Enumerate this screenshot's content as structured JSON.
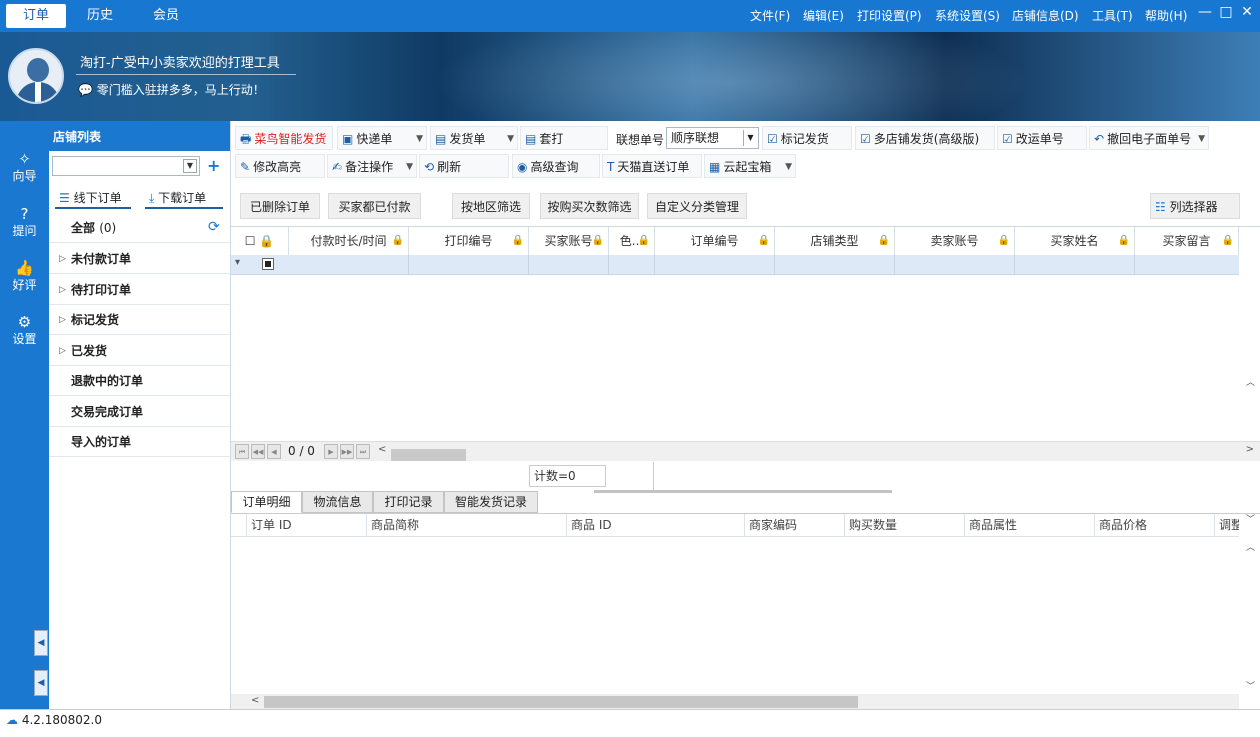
{
  "top_tabs": [
    "订单",
    "历史",
    "会员"
  ],
  "menu": [
    "文件(F)",
    "编辑(E)",
    "打印设置(P)",
    "系统设置(S)",
    "店铺信息(D)",
    "工具(T)",
    "帮助(H)"
  ],
  "window": {
    "minimize": "—",
    "maximize": "□",
    "close": "✕"
  },
  "banner": {
    "slogan1": "淘打-广受中小卖家欢迎的打理工具",
    "slogan2": "零门槛入驻拼多多，马上行动！"
  },
  "leftnav": [
    {
      "label": "向导",
      "icon": "wand-icon"
    },
    {
      "label": "提问",
      "icon": "question-icon"
    },
    {
      "label": "好评",
      "icon": "thumbs-up-icon"
    },
    {
      "label": "设置",
      "icon": "gear-icon"
    }
  ],
  "shops": {
    "header": "店铺列表",
    "offline_order": "线下订单",
    "download_order": "下载订单",
    "tree": [
      {
        "label": "全部",
        "count": "(0)",
        "expand": false
      },
      {
        "label": "未付款订单",
        "expand": true
      },
      {
        "label": "待打印订单",
        "expand": true
      },
      {
        "label": "标记发货",
        "expand": true
      },
      {
        "label": "已发货",
        "expand": true
      },
      {
        "label": "退款中的订单",
        "expand": false
      },
      {
        "label": "交易完成订单",
        "expand": false
      },
      {
        "label": "导入的订单",
        "expand": false
      }
    ]
  },
  "toolbar1": {
    "cainiao": "菜鸟智能发货",
    "kuaidi": "快递单",
    "fahuo": "发货单",
    "taoda": "套打",
    "lianxiang_label": "联想单号",
    "lianxiang_value": "顺序联想",
    "biaoji": "标记发货",
    "duodian": "多店铺发货(高级版)",
    "gaiyun": "改运单号",
    "chehui": "撤回电子面单号"
  },
  "toolbar2": {
    "xiugai": "修改高亮",
    "beizhu": "备注操作",
    "shuaxin": "刷新",
    "gaoji": "高级查询",
    "tianmao": "天猫直送订单",
    "yunqi": "云起宝箱"
  },
  "filters": [
    "已删除订单",
    "买家都已付款",
    "按地区筛选",
    "按购买次数筛选",
    "自定义分类管理"
  ],
  "col_selector": "列选择器",
  "grid_headers": [
    "付款时长/时间",
    "打印编号",
    "买家账号",
    "色...",
    "订单编号",
    "店铺类型",
    "卖家账号",
    "买家姓名",
    "买家留言"
  ],
  "pager": {
    "text": "0 / 0"
  },
  "count": "计数=0",
  "bottom_tabs": [
    "订单明细",
    "物流信息",
    "打印记录",
    "智能发货记录"
  ],
  "bottom_headers": [
    "订单 ID",
    "商品简称",
    "商品 ID",
    "商家编码",
    "购买数量",
    "商品属性",
    "商品价格",
    "调整"
  ],
  "status": {
    "version": "4.2.180802.0"
  },
  "colors": {
    "accent": "#1b78d1",
    "selected_row": "#dde9f6"
  }
}
